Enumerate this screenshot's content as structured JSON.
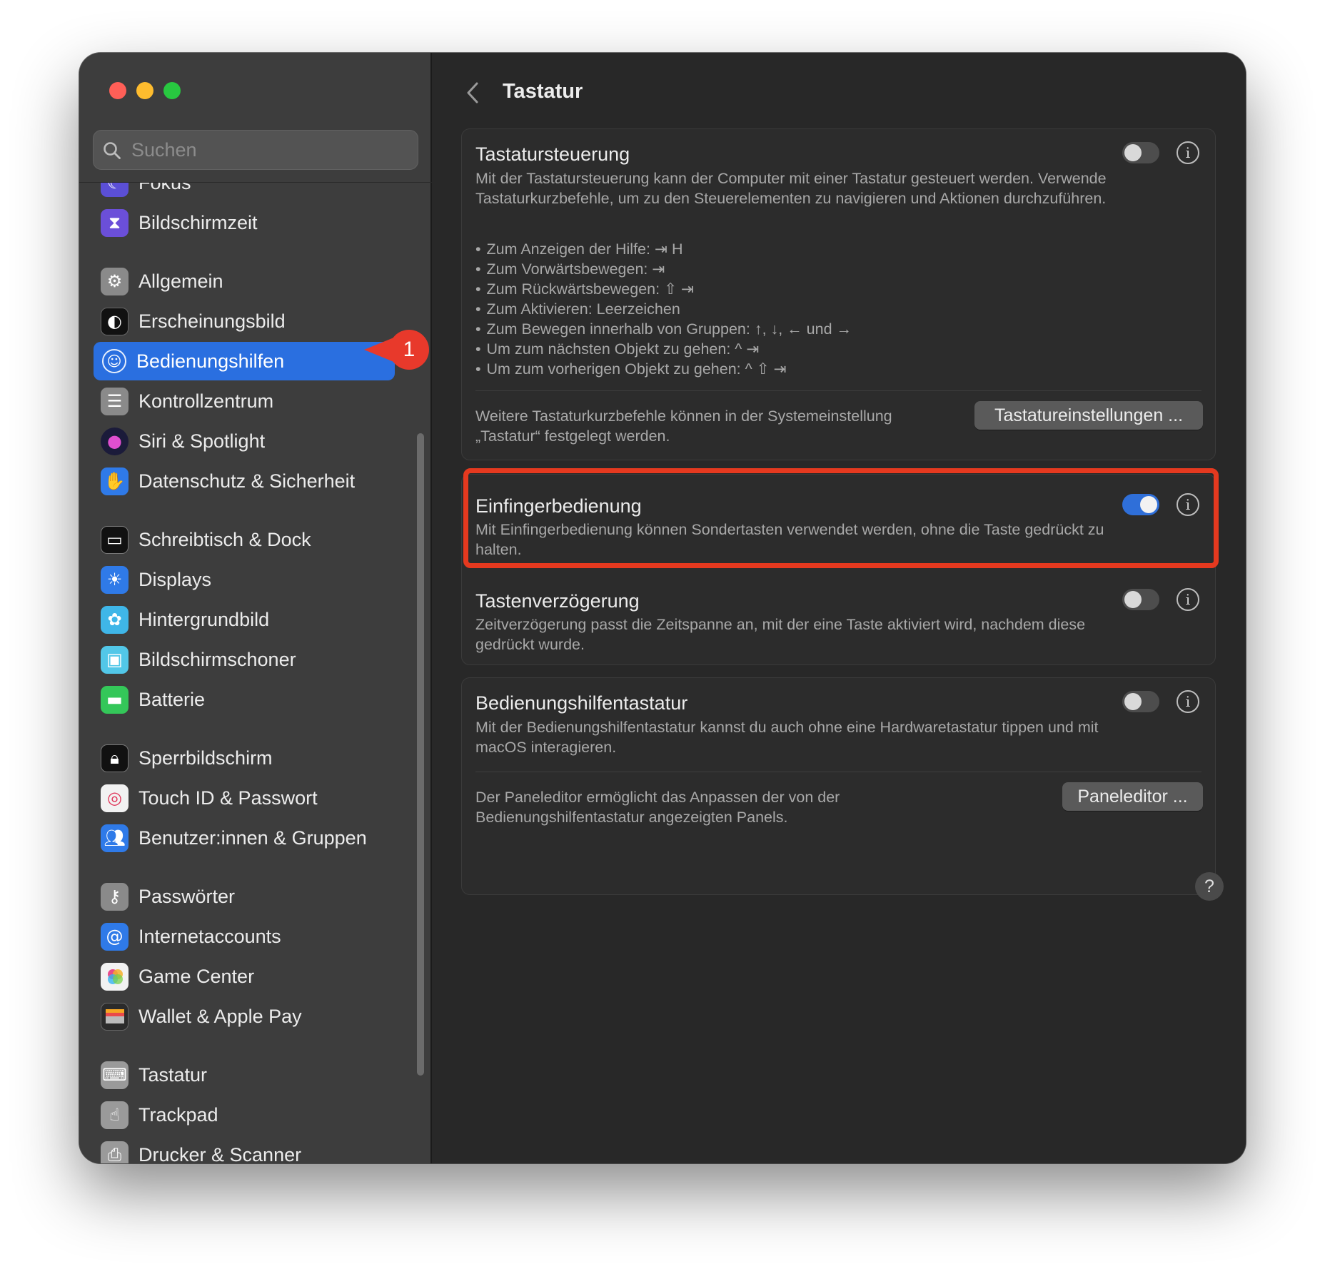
{
  "sidebar": {
    "search_placeholder": "Suchen",
    "partial_item_label": "Fokus",
    "items": [
      {
        "label": "Bildschirmzeit",
        "icon": "hourglass-icon"
      },
      {
        "label": "Allgemein",
        "icon": "gear-icon"
      },
      {
        "label": "Erscheinungsbild",
        "icon": "appearance-icon"
      },
      {
        "label": "Bedienungshilfen",
        "icon": "accessibility-icon"
      },
      {
        "label": "Kontrollzentrum",
        "icon": "control-center-icon"
      },
      {
        "label": "Siri & Spotlight",
        "icon": "siri-icon"
      },
      {
        "label": "Datenschutz & Sicherheit",
        "icon": "hand-icon"
      },
      {
        "label": "Schreibtisch & Dock",
        "icon": "dock-icon"
      },
      {
        "label": "Displays",
        "icon": "sun-icon"
      },
      {
        "label": "Hintergrundbild",
        "icon": "flower-icon"
      },
      {
        "label": "Bildschirmschoner",
        "icon": "screensaver-icon"
      },
      {
        "label": "Batterie",
        "icon": "battery-icon"
      },
      {
        "label": "Sperrbildschirm",
        "icon": "lock-icon"
      },
      {
        "label": "Touch ID & Passwort",
        "icon": "fingerprint-icon"
      },
      {
        "label": "Benutzer:innen & Gruppen",
        "icon": "users-icon"
      },
      {
        "label": "Passwörter",
        "icon": "key-icon"
      },
      {
        "label": "Internetaccounts",
        "icon": "at-icon"
      },
      {
        "label": "Game Center",
        "icon": "game-center-icon"
      },
      {
        "label": "Wallet & Apple Pay",
        "icon": "wallet-icon"
      },
      {
        "label": "Tastatur",
        "icon": "keyboard-icon"
      },
      {
        "label": "Trackpad",
        "icon": "trackpad-icon"
      },
      {
        "label": "Drucker & Scanner",
        "icon": "printer-icon"
      }
    ],
    "badge": "1"
  },
  "header": {
    "title": "Tastatur"
  },
  "keyboard_control": {
    "title": "Tastatursteuerung",
    "toggle_on": false,
    "description": "Mit der Tastatursteuerung kann der Computer mit einer Tastatur gesteuert werden. Verwende Tastaturkurzbefehle, um zu den Steuerelementen zu navigieren und Aktionen durchzuführen.",
    "bullets": [
      "Zum Anzeigen der Hilfe: ⇥ H",
      "Zum Vorwärtsbewegen: ⇥",
      "Zum Rückwärtsbewegen: ⇧ ⇥",
      "Zum Aktivieren: Leerzeichen",
      "Zum Bewegen innerhalb von Gruppen: ↑, ↓, ← und →",
      "Um zum nächsten Objekt zu gehen: ^ ⇥",
      "Um zum vorherigen Objekt zu gehen: ^ ⇧ ⇥"
    ],
    "footer_text": "Weitere Tastaturkurzbefehle können in der Systemeinstellung „Tastatur“ festgelegt werden.",
    "button": "Tastatureinstellungen ..."
  },
  "sticky_keys": {
    "title": "Einfingerbedienung",
    "toggle_on": true,
    "description": "Mit Einfingerbedienung können Sondertasten verwendet werden, ohne die Taste gedrückt zu halten."
  },
  "slow_keys": {
    "title": "Tastenverzögerung",
    "toggle_on": false,
    "description": "Zeitverzögerung passt die Zeitspanne an, mit der eine Taste aktiviert wird, nachdem diese gedrückt wurde."
  },
  "accessibility_keyboard": {
    "title": "Bedienungshilfentastatur",
    "toggle_on": false,
    "description": "Mit der Bedienungshilfentastatur kannst du auch ohne eine Hardwaretastatur tippen und mit macOS interagieren.",
    "footer_text": "Der Paneleditor ermöglicht das Anpassen der von der Bedienungshilfentastatur angezeigten Panels.",
    "button": "Paneleditor ..."
  },
  "help_label": "?",
  "info_label": "i",
  "colors": {
    "accent": "#2a6fe0",
    "highlight": "#e5391f",
    "badge": "#e8392b"
  }
}
